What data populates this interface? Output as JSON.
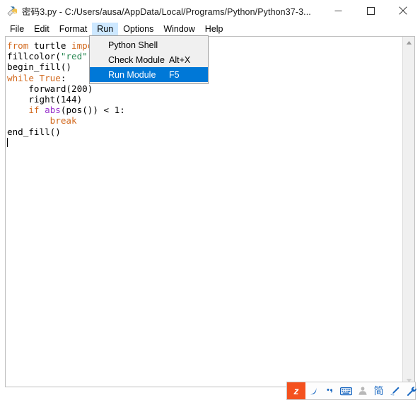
{
  "window": {
    "title": "密码3.py - C:/Users/ausa/AppData/Local/Programs/Python/Python37-3...",
    "app_icon": "python-idle-icon",
    "controls": {
      "minimize": "minimize-icon",
      "maximize": "maximize-icon",
      "close": "close-icon"
    }
  },
  "menubar": {
    "items": [
      {
        "label": "File",
        "active": false
      },
      {
        "label": "Edit",
        "active": false
      },
      {
        "label": "Format",
        "active": false
      },
      {
        "label": "Run",
        "active": true
      },
      {
        "label": "Options",
        "active": false
      },
      {
        "label": "Window",
        "active": false
      },
      {
        "label": "Help",
        "active": false
      }
    ]
  },
  "run_menu": {
    "open": true,
    "items": [
      {
        "label": "Python Shell",
        "accel": "",
        "selected": false
      },
      {
        "label": "Check Module",
        "accel": "Alt+X",
        "selected": false
      },
      {
        "label": "Run Module",
        "accel": "F5",
        "selected": true
      }
    ]
  },
  "editor": {
    "lines": [
      [
        {
          "t": "from",
          "c": "kw"
        },
        {
          "t": " turtle ",
          "c": ""
        },
        {
          "t": "impor",
          "c": "kw"
        }
      ],
      [
        {
          "t": "fillcolor(",
          "c": ""
        },
        {
          "t": "\"red\"",
          "c": "str"
        },
        {
          "t": ")",
          "c": ""
        }
      ],
      [
        {
          "t": "begin_fill()",
          "c": ""
        }
      ],
      [
        {
          "t": "while",
          "c": "kw"
        },
        {
          "t": " ",
          "c": ""
        },
        {
          "t": "True",
          "c": "kw"
        },
        {
          "t": ":",
          "c": ""
        }
      ],
      [
        {
          "t": "    forward(200)",
          "c": ""
        }
      ],
      [
        {
          "t": "    right(144)",
          "c": ""
        }
      ],
      [
        {
          "t": "    ",
          "c": ""
        },
        {
          "t": "if",
          "c": "kw"
        },
        {
          "t": " ",
          "c": ""
        },
        {
          "t": "abs",
          "c": "bltn"
        },
        {
          "t": "(pos()) < 1:",
          "c": ""
        }
      ],
      [
        {
          "t": "        ",
          "c": ""
        },
        {
          "t": "break",
          "c": "kw"
        }
      ],
      [
        {
          "t": "end_fill()",
          "c": ""
        }
      ]
    ],
    "caret_line": 10,
    "colors": {
      "keyword": "#d2691e",
      "builtin": "#9932cc",
      "string": "#2e8b57",
      "text": "#000000",
      "background": "#ffffff"
    }
  },
  "scrollbar": {
    "up_arrow": "chevron-up-icon",
    "down_arrow": "chevron-down-icon"
  },
  "ime_toolbar": {
    "logo_label": "z",
    "buttons": [
      {
        "name": "sogou-logo",
        "glyph": ""
      },
      {
        "name": "moon-icon",
        "glyph": ""
      },
      {
        "name": "punctuation-icon",
        "glyph": ""
      },
      {
        "name": "soft-keyboard-icon",
        "glyph": ""
      },
      {
        "name": "user-icon",
        "glyph": ""
      },
      {
        "name": "simplified-chinese-icon",
        "glyph": "简"
      },
      {
        "name": "pen-icon",
        "glyph": ""
      },
      {
        "name": "toolbox-icon",
        "glyph": ""
      }
    ]
  }
}
